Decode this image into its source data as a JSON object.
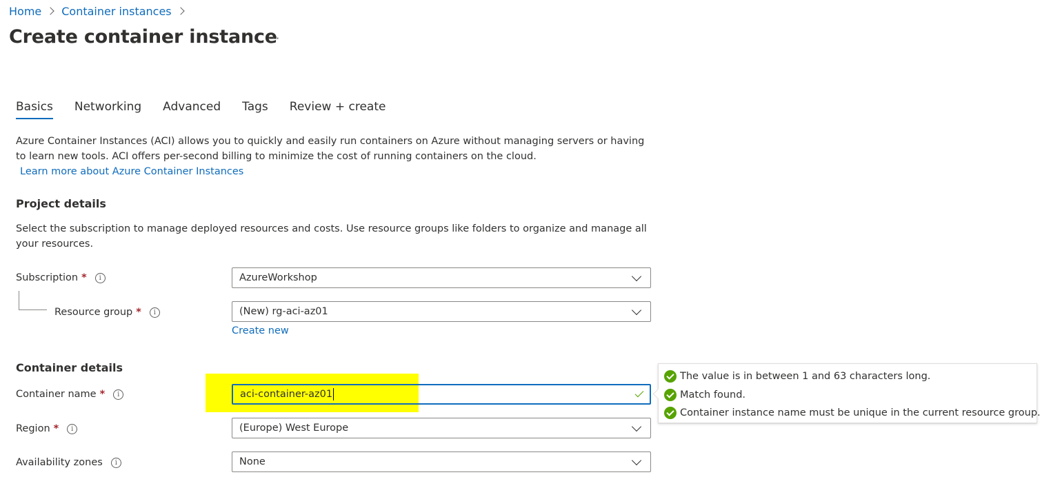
{
  "breadcrumb": {
    "items": [
      "Home",
      "Container instances"
    ]
  },
  "page": {
    "title": "Create container instance",
    "more_label": "···"
  },
  "tabs": [
    {
      "label": "Basics",
      "active": true
    },
    {
      "label": "Networking",
      "active": false
    },
    {
      "label": "Advanced",
      "active": false
    },
    {
      "label": "Tags",
      "active": false
    },
    {
      "label": "Review + create",
      "active": false
    }
  ],
  "intro": {
    "text": "Azure Container Instances (ACI) allows you to quickly and easily run containers on Azure without managing servers or having to learn new tools. ACI offers per-second billing to minimize the cost of running containers on the cloud.",
    "learn_more": "Learn more about Azure Container Instances"
  },
  "project_details": {
    "title": "Project details",
    "description": "Select the subscription to manage deployed resources and costs. Use resource groups like folders to organize and manage all your resources.",
    "subscription": {
      "label": "Subscription",
      "required": "*",
      "value": "AzureWorkshop"
    },
    "resource_group": {
      "label": "Resource group",
      "required": "*",
      "value": "(New) rg-aci-az01",
      "create_new": "Create new"
    }
  },
  "container_details": {
    "title": "Container details",
    "container_name": {
      "label": "Container name",
      "required": "*",
      "value": "aci-container-az01"
    },
    "region": {
      "label": "Region",
      "required": "*",
      "value": "(Europe) West Europe"
    },
    "availability_zones": {
      "label": "Availability zones",
      "value": "None"
    }
  },
  "validation": {
    "messages": [
      "The value is in between 1 and 63 characters long.",
      "Match found.",
      "Container instance name must be unique in the current resource group."
    ]
  },
  "colors": {
    "accent": "#0f6cbd",
    "success": "#57a300",
    "highlight": "#ffff00",
    "required": "#a4262c"
  },
  "icons": {
    "info": "info-icon",
    "chevron": "chevron-down-icon",
    "valid": "checkmark-icon"
  }
}
